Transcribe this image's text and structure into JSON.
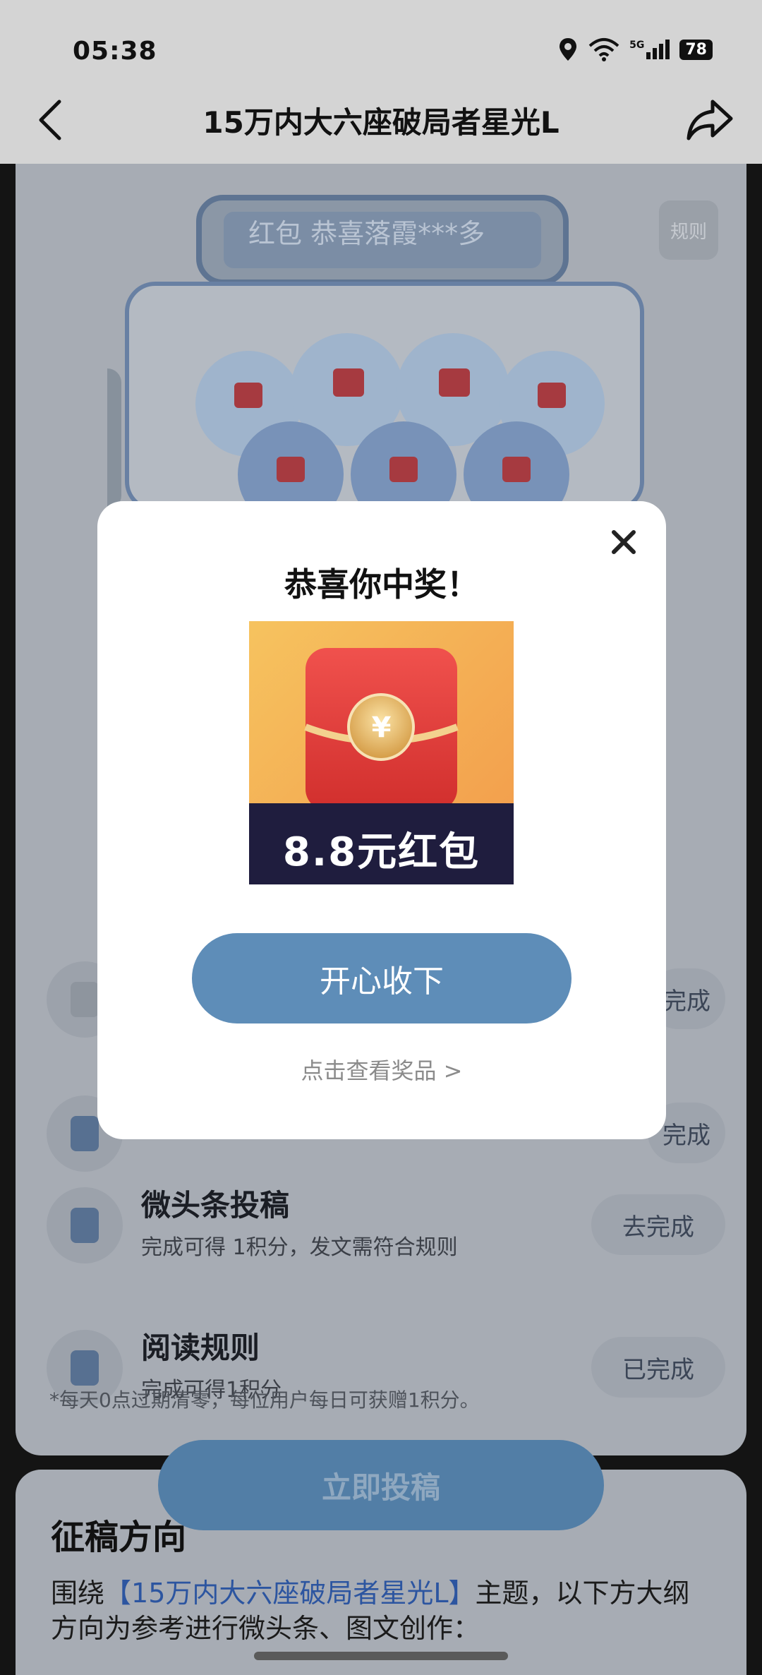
{
  "status_bar": {
    "time": "05:38",
    "battery": "78",
    "network": "5G"
  },
  "header": {
    "title": "15万内大六座破局者星光L"
  },
  "machine": {
    "ticker_text": "红包  恭喜落霞***多",
    "rules_label": "规则"
  },
  "tasks": [
    {
      "title": "",
      "desc": "",
      "button": "完成"
    },
    {
      "title": "",
      "desc": "",
      "button": "完成"
    },
    {
      "title": "微头条投稿",
      "desc": "完成可得 1积分，发文需符合规则",
      "button": "去完成"
    },
    {
      "title": "阅读规则",
      "desc": "完成可得1积分",
      "button": "已完成"
    }
  ],
  "note": "*每天0点过期清零，每位用户每日可获赠1积分。",
  "submit_button": "立即投稿",
  "guide": {
    "title": "征稿方向",
    "text_prefix": "围绕",
    "text_highlight": "【15万内大六座破局者星光L】",
    "text_suffix": "主题，以下方大纲方向为参考进行微头条、图文创作："
  },
  "modal": {
    "title": "恭喜你中奖！",
    "prize_label": "8.8元红包",
    "coin_symbol": "¥",
    "accept_button": "开心收下",
    "view_prizes_link": "点击查看奖品 >"
  },
  "colors": {
    "accent": "#5e8db8",
    "envelope_red": "#e0393a",
    "highlight_blue": "#2c55a0"
  }
}
